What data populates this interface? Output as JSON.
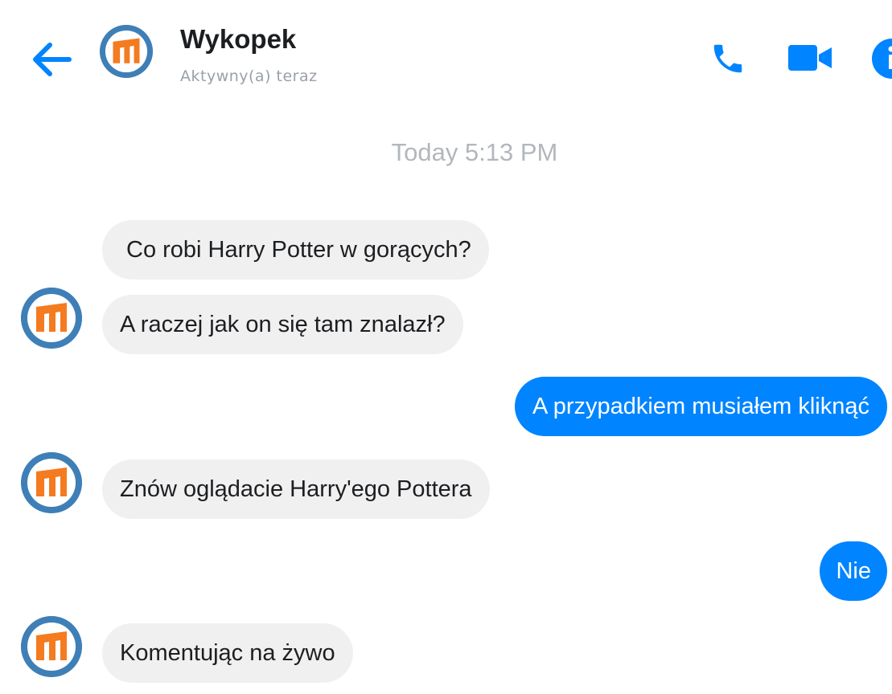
{
  "header": {
    "contact_name": "Wykopek",
    "status": "Aktywny(a) teraz",
    "back_icon": "arrow-left-icon",
    "call_icon": "phone-icon",
    "video_icon": "video-camera-icon",
    "info_icon": "info-icon",
    "accent_color": "#0084ff"
  },
  "conversation": {
    "timestamp": "Today 5:13 PM",
    "messages": [
      {
        "direction": "incoming",
        "text": "Co robi Harry Potter w gorących?"
      },
      {
        "direction": "incoming",
        "text": "A raczej jak on się tam znalazł?"
      },
      {
        "direction": "outgoing",
        "text": "A przypadkiem musiałem kliknąć"
      },
      {
        "direction": "incoming",
        "text": "Znów oglądacie Harry'ego Pottera"
      },
      {
        "direction": "outgoing",
        "text": "Nie"
      },
      {
        "direction": "incoming",
        "text": "Komentując na żywo"
      }
    ]
  },
  "colors": {
    "incoming_bubble": "#f0f0f0",
    "outgoing_bubble": "#0084ff",
    "avatar_ring": "#3f7fb7",
    "avatar_logo": "#f47b20"
  }
}
